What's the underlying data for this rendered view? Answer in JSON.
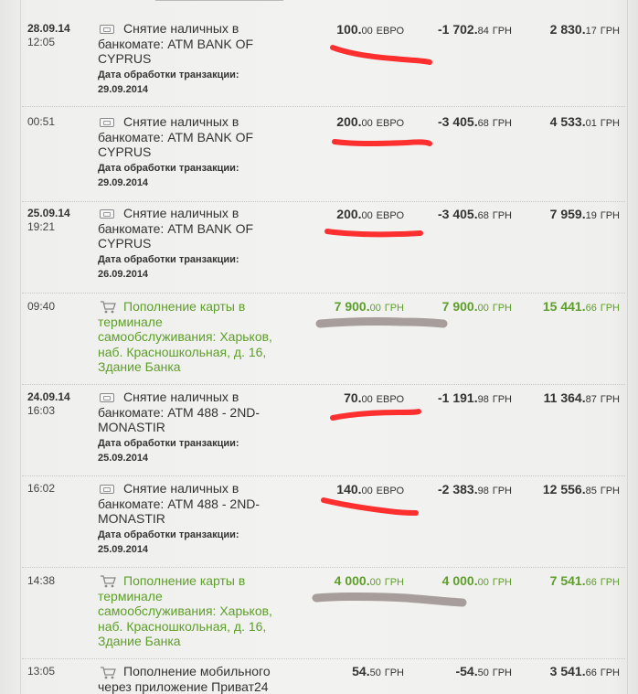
{
  "colors": {
    "accent_green": "#5e9e2a",
    "redact_red": "#ff1a1a",
    "redact_gray": "#8e8280"
  },
  "transactions": [
    {
      "date": "28.09.14",
      "time": "12:05",
      "icon": "card-icon",
      "type": "withdrawal",
      "desc": "Снятие наличных в банкомате: ATM BANK OF CYPRUS",
      "proc_label": "Дата обработки транзакции:",
      "proc_date": "29.09.2014",
      "amount_int": "100.",
      "amount_dec": "00",
      "amount_cur": "ЕВРО",
      "change_int": "-1 702.",
      "change_dec": "84",
      "change_cur": "ГРН",
      "balance_int": "2 830.",
      "balance_dec": "17",
      "balance_cur": "ГРН"
    },
    {
      "date": "",
      "time": "00:51",
      "icon": "card-icon",
      "type": "withdrawal",
      "desc": "Снятие наличных в банкомате: ATM BANK OF CYPRUS",
      "proc_label": "Дата обработки транзакции:",
      "proc_date": "29.09.2014",
      "amount_int": "200.",
      "amount_dec": "00",
      "amount_cur": "ЕВРО",
      "change_int": "-3 405.",
      "change_dec": "68",
      "change_cur": "ГРН",
      "balance_int": "4 533.",
      "balance_dec": "01",
      "balance_cur": "ГРН"
    },
    {
      "date": "25.09.14",
      "time": "19:21",
      "icon": "card-icon",
      "type": "withdrawal",
      "desc": "Снятие наличных в банкомате: ATM BANK OF CYPRUS",
      "proc_label": "Дата обработки транзакции:",
      "proc_date": "26.09.2014",
      "amount_int": "200.",
      "amount_dec": "00",
      "amount_cur": "ЕВРО",
      "change_int": "-3 405.",
      "change_dec": "68",
      "change_cur": "ГРН",
      "balance_int": "7 959.",
      "balance_dec": "19",
      "balance_cur": "ГРН"
    },
    {
      "date": "",
      "time": "09:40",
      "icon": "cart-icon",
      "type": "topup",
      "desc": "Пополнение карты в терминале самообслуживания: Харьков, наб. Красношкольная, д. 16, Здание Банка",
      "proc_label": "",
      "proc_date": "",
      "amount_int": "7 900.",
      "amount_dec": "00",
      "amount_cur": "ГРН",
      "change_int": "7 900.",
      "change_dec": "00",
      "change_cur": "ГРН",
      "balance_int": "15 441.",
      "balance_dec": "66",
      "balance_cur": "ГРН"
    },
    {
      "date": "24.09.14",
      "time": "16:03",
      "icon": "card-icon",
      "type": "withdrawal",
      "desc": "Снятие наличных в банкомате: ATM 488 - 2ND-MONASTIR",
      "proc_label": "Дата обработки транзакции:",
      "proc_date": "25.09.2014",
      "amount_int": "70.",
      "amount_dec": "00",
      "amount_cur": "ЕВРО",
      "change_int": "-1 191.",
      "change_dec": "98",
      "change_cur": "ГРН",
      "balance_int": "11 364.",
      "balance_dec": "87",
      "balance_cur": "ГРН"
    },
    {
      "date": "",
      "time": "16:02",
      "icon": "card-icon",
      "type": "withdrawal",
      "desc": "Снятие наличных в банкомате: ATM 488 - 2ND-MONASTIR",
      "proc_label": "Дата обработки транзакции:",
      "proc_date": "25.09.2014",
      "amount_int": "140.",
      "amount_dec": "00",
      "amount_cur": "ЕВРО",
      "change_int": "-2 383.",
      "change_dec": "98",
      "change_cur": "ГРН",
      "balance_int": "12 556.",
      "balance_dec": "85",
      "balance_cur": "ГРН"
    },
    {
      "date": "",
      "time": "14:38",
      "icon": "cart-icon",
      "type": "topup",
      "desc": "Пополнение карты в терминале самообслуживания: Харьков, наб. Красношкольная, д. 16, Здание Банка",
      "proc_label": "",
      "proc_date": "",
      "amount_int": "4 000.",
      "amount_dec": "00",
      "amount_cur": "ГРН",
      "change_int": "4 000.",
      "change_dec": "00",
      "change_cur": "ГРН",
      "balance_int": "7 541.",
      "balance_dec": "66",
      "balance_cur": "ГРН"
    },
    {
      "date": "",
      "time": "13:05",
      "icon": "cart-icon",
      "type": "payment",
      "desc": "Пополнение мобильного через приложение Приват24",
      "proc_label": "",
      "proc_date": "",
      "amount_int": "54.",
      "amount_dec": "50",
      "amount_cur": "ГРН",
      "change_int": "-54.",
      "change_dec": "50",
      "change_cur": "ГРН",
      "balance_int": "3 541.",
      "balance_dec": "66",
      "balance_cur": "ГРН"
    }
  ]
}
